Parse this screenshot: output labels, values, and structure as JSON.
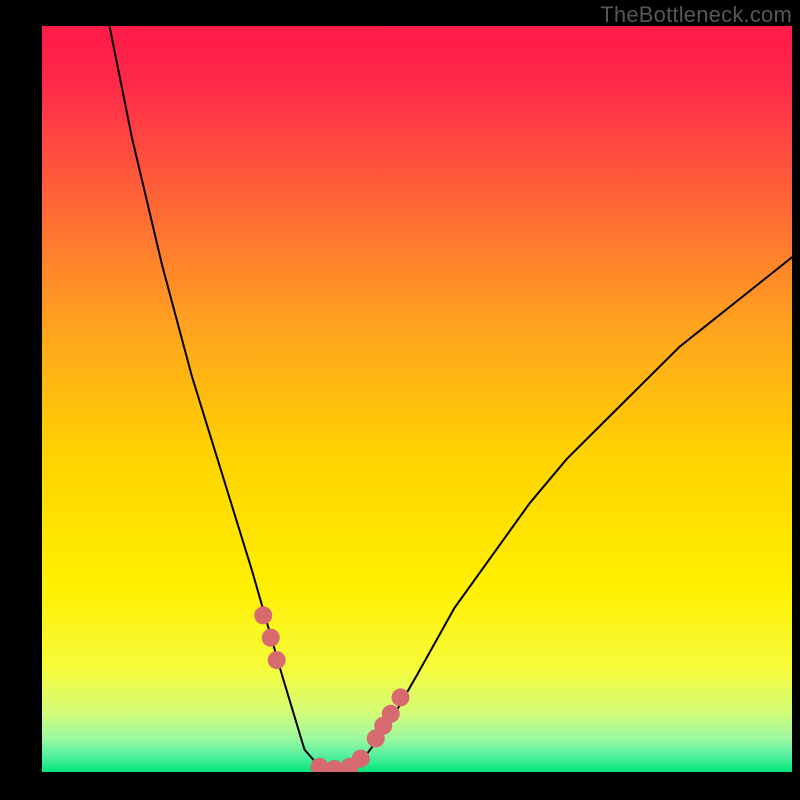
{
  "watermark": "TheBottleneck.com",
  "chart_data": {
    "type": "line",
    "title": "",
    "xlabel": "",
    "ylabel": "",
    "xlim": [
      0,
      100
    ],
    "ylim": [
      0,
      100
    ],
    "background_gradient": {
      "top": "#ff1a4a",
      "mid": "#ffe600",
      "bottom": "#00e676"
    },
    "curve": {
      "description": "V-shaped bottleneck curve",
      "x": [
        9,
        12,
        16,
        20,
        24,
        28,
        30,
        32,
        33.5,
        35,
        37,
        39,
        41,
        43,
        46,
        50,
        55,
        60,
        65,
        70,
        75,
        80,
        85,
        90,
        95,
        100
      ],
      "y": [
        100,
        85,
        68,
        53,
        40,
        27,
        20,
        13,
        8,
        3,
        0.7,
        0.4,
        0.5,
        2,
        6,
        13,
        22,
        29,
        36,
        42,
        47,
        52,
        57,
        61,
        65,
        69
      ]
    },
    "markers": {
      "color": "#d76a6f",
      "points_x": [
        29.5,
        30.5,
        31.3,
        37,
        39,
        41,
        42.5,
        44.5,
        45.5,
        46.5,
        47.8
      ],
      "points_y": [
        21,
        18,
        15,
        0.7,
        0.4,
        0.7,
        1.8,
        4.5,
        6.2,
        7.8,
        10
      ]
    }
  }
}
